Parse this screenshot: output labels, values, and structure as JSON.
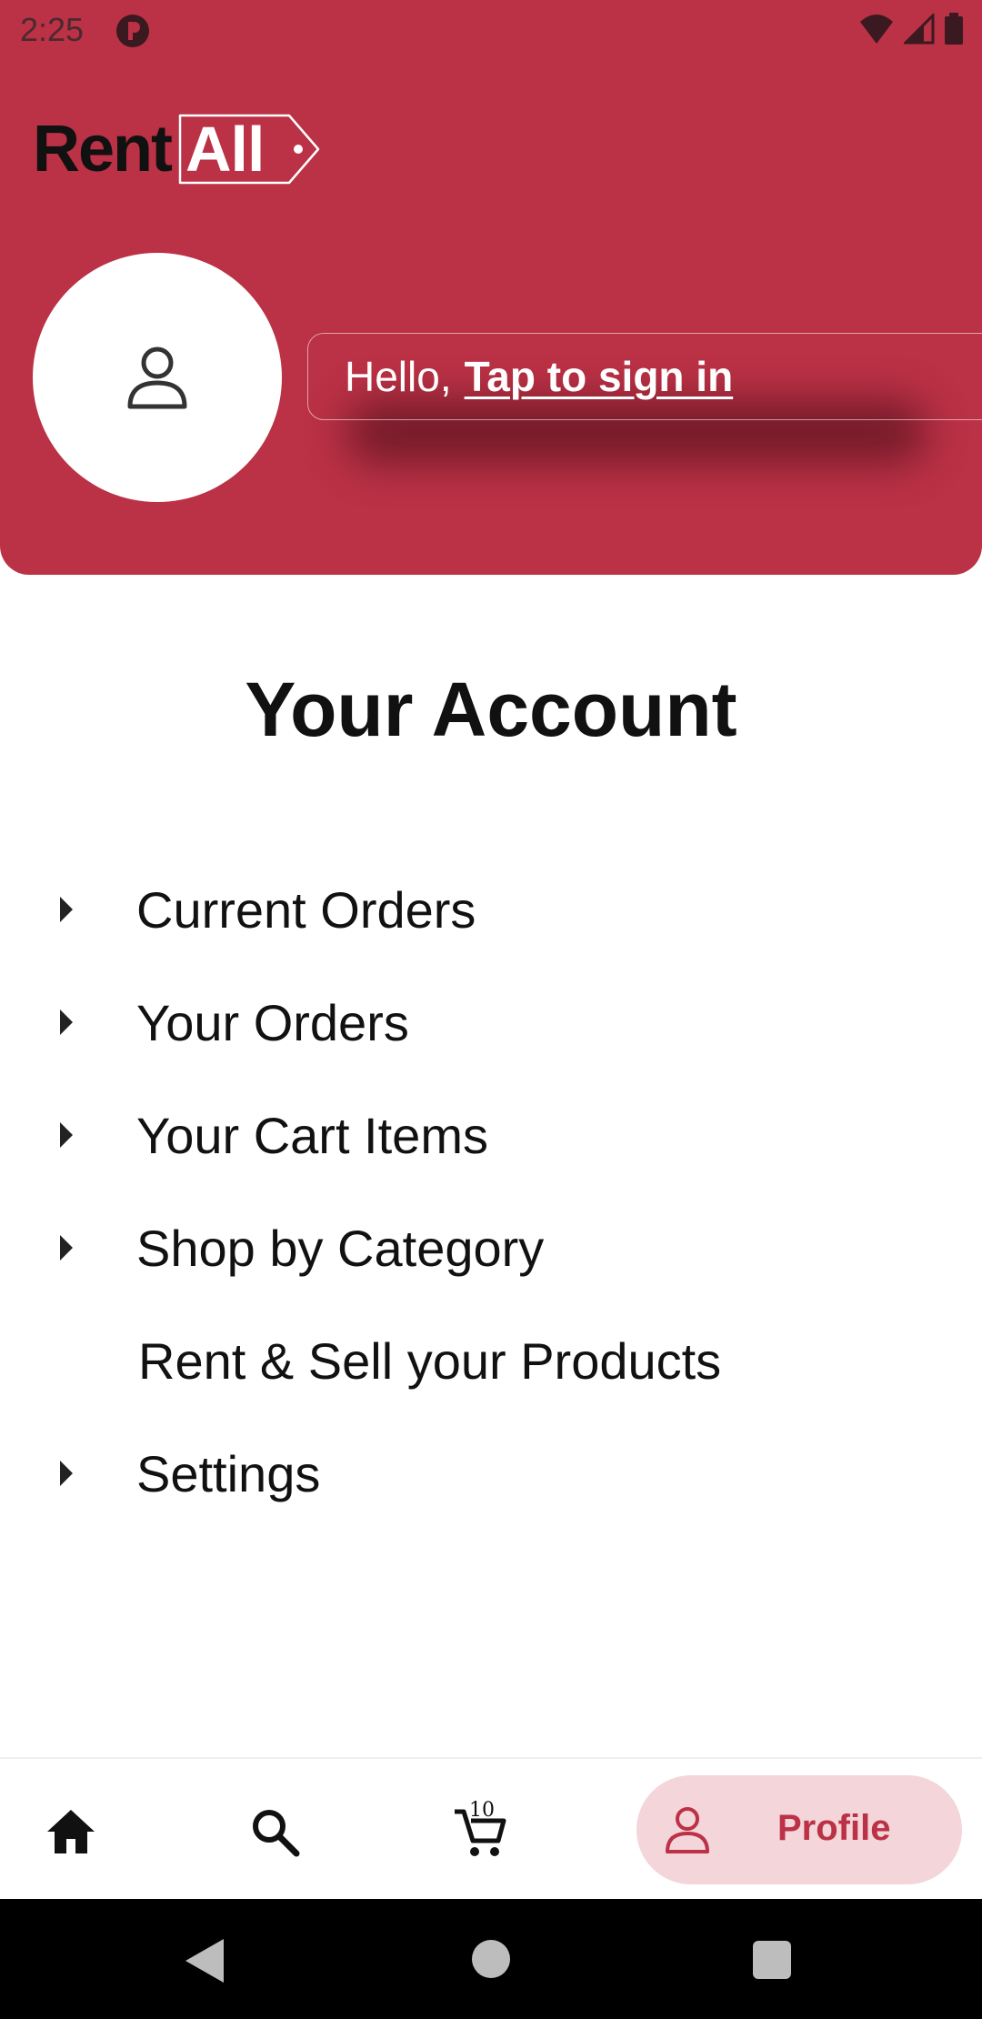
{
  "status_bar": {
    "time": "2:25"
  },
  "header": {
    "logo": {
      "part1": "Rent",
      "part2": "All"
    },
    "greeting": "Hello,",
    "sign_in_link": "Tap to sign in",
    "background_color": "#bb3145"
  },
  "main": {
    "title": "Your Account",
    "menu": [
      {
        "label": "Current Orders",
        "has_arrow": true
      },
      {
        "label": "Your Orders",
        "has_arrow": true
      },
      {
        "label": "Your Cart Items",
        "has_arrow": true
      },
      {
        "label": "Shop by Category",
        "has_arrow": true
      },
      {
        "label": "Rent & Sell your Products",
        "has_arrow": false
      },
      {
        "label": "Settings",
        "has_arrow": true
      }
    ]
  },
  "bottom_nav": {
    "home_icon": "home-icon",
    "search_icon": "search-icon",
    "cart_icon": "cart-icon",
    "cart_count": "10",
    "active": {
      "label": "Profile",
      "icon": "person-icon"
    },
    "accent_color": "#bb3145",
    "active_background": "#f3d5da"
  }
}
